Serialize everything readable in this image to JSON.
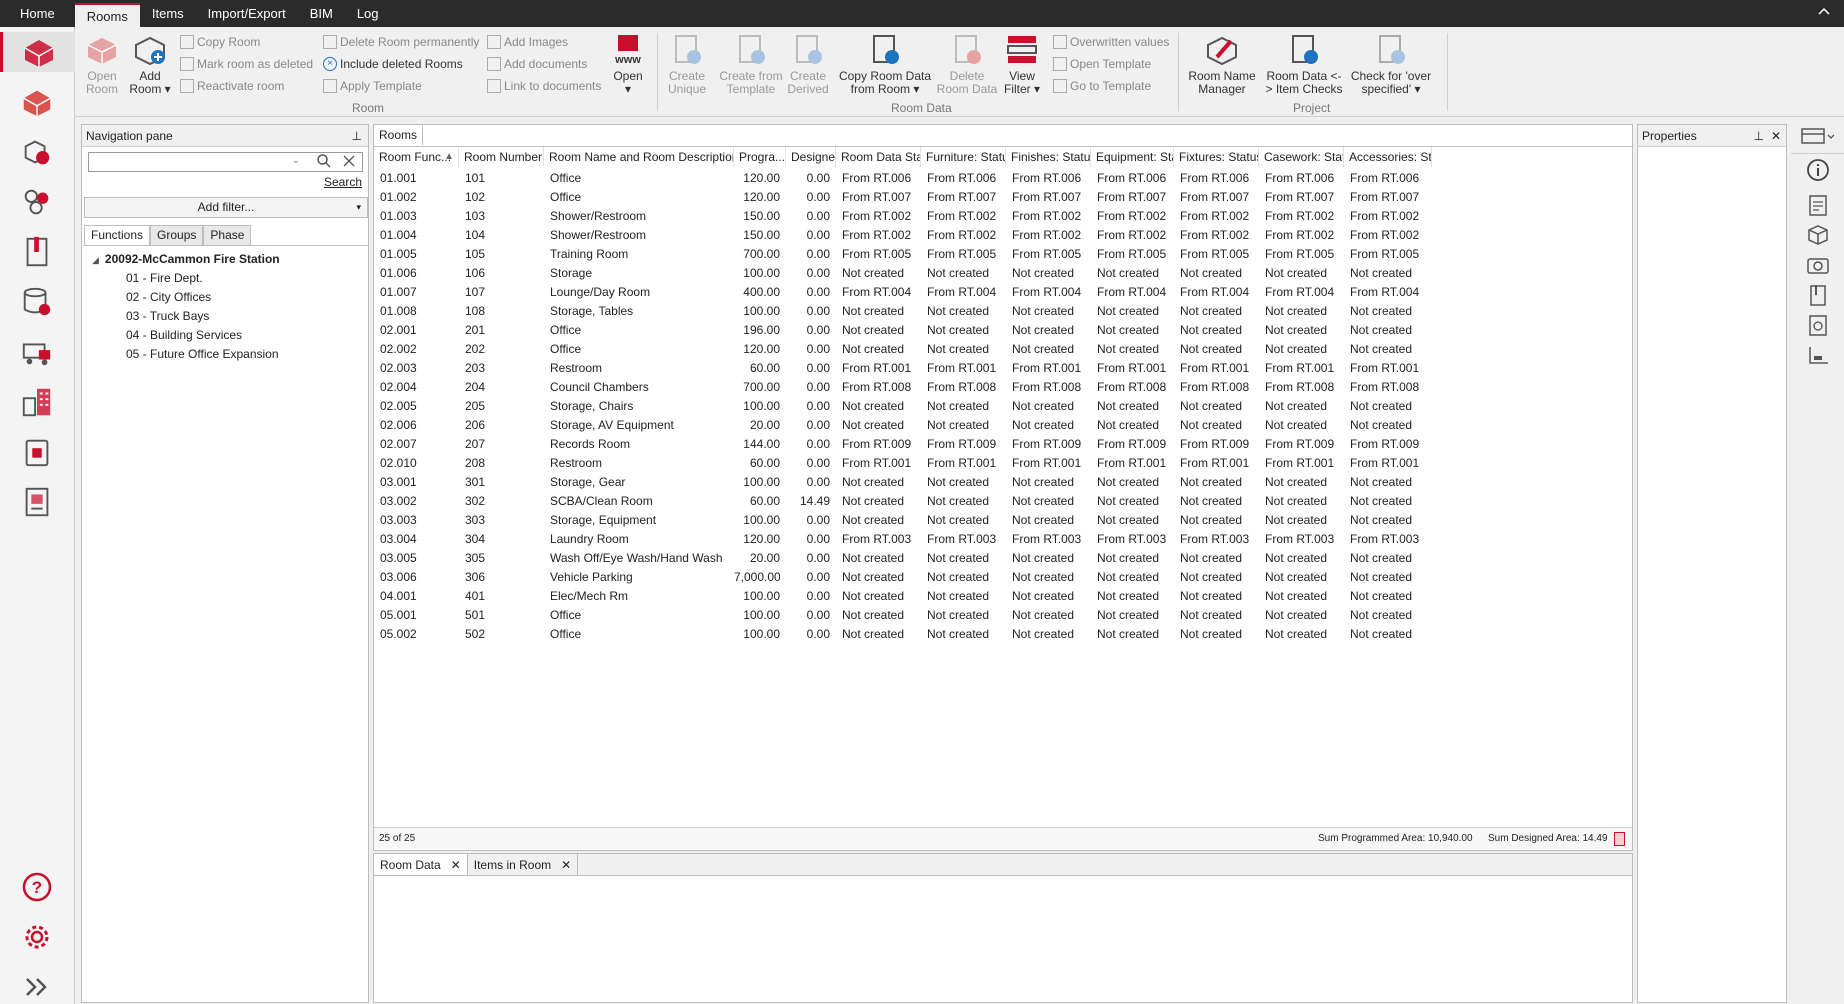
{
  "menu": {
    "tabs": [
      "Home",
      "Rooms",
      "Items",
      "Import/Export",
      "BIM",
      "Log"
    ],
    "active": "Rooms"
  },
  "ribbon": {
    "open_room": "Open\nRoom",
    "add_room": "Add\nRoom ▾",
    "copy_room": "Copy Room",
    "mark_deleted": "Mark room as deleted",
    "reactivate": "Reactivate room",
    "delete_permanently": "Delete Room permanently",
    "include_deleted": "Include deleted Rooms",
    "apply_template": "Apply Template",
    "add_images": "Add Images",
    "add_documents": "Add documents",
    "link_documents": "Link to documents",
    "open_www": "Open\n▾",
    "create_unique": "Create\nUnique",
    "create_from_template": "Create from\nTemplate",
    "create_derived": "Create\nDerived",
    "copy_room_data": "Copy Room Data\nfrom Room ▾",
    "delete_room_data": "Delete\nRoom Data",
    "view_filter": "View\nFilter ▾",
    "overwritten_values": "Overwritten values",
    "open_template": "Open Template",
    "go_to_template": "Go to Template",
    "room_name_manager": "Room Name\nManager",
    "room_data_item_checks": "Room Data <-\n> Item Checks",
    "check_over_specified": "Check for 'over\nspecified' ▾",
    "group_room": "Room",
    "group_room_data": "Room Data",
    "group_project": "Project",
    "www_label": "www"
  },
  "nav": {
    "title": "Navigation pane",
    "search_placeholder": "",
    "search_link": "Search",
    "add_filter": "Add filter...",
    "tabs": [
      "Functions",
      "Groups",
      "Phase"
    ],
    "root": "20092-McCammon Fire Station",
    "items": [
      "01 - Fire Dept.",
      "02 - City Offices",
      "03 - Truck Bays",
      "04 - Building Services",
      "05 - Future Office Expansion"
    ]
  },
  "rooms": {
    "tab_label": "Rooms",
    "columns": [
      "Room Func...",
      "Room Number",
      "Room Name and Room Description",
      "Progra...",
      "Designe...",
      "Room Data Stat...",
      "Furniture: Status",
      "Finishes: Status",
      "Equipment: Sta...",
      "Fixtures: Status",
      "Casework: Status",
      "Accessories: Sta..."
    ],
    "rows": [
      [
        "01.001",
        "101",
        "Office",
        "120.00",
        "0.00",
        "From RT.006"
      ],
      [
        "01.002",
        "102",
        "Office",
        "120.00",
        "0.00",
        "From RT.007"
      ],
      [
        "01.003",
        "103",
        "Shower/Restroom",
        "150.00",
        "0.00",
        "From RT.002"
      ],
      [
        "01.004",
        "104",
        "Shower/Restroom",
        "150.00",
        "0.00",
        "From RT.002"
      ],
      [
        "01.005",
        "105",
        "Training Room",
        "700.00",
        "0.00",
        "From RT.005"
      ],
      [
        "01.006",
        "106",
        "Storage",
        "100.00",
        "0.00",
        "Not created"
      ],
      [
        "01.007",
        "107",
        "Lounge/Day Room",
        "400.00",
        "0.00",
        "From RT.004"
      ],
      [
        "01.008",
        "108",
        "Storage, Tables",
        "100.00",
        "0.00",
        "Not created"
      ],
      [
        "02.001",
        "201",
        "Office",
        "196.00",
        "0.00",
        "Not created"
      ],
      [
        "02.002",
        "202",
        "Office",
        "120.00",
        "0.00",
        "Not created"
      ],
      [
        "02.003",
        "203",
        "Restroom",
        "60.00",
        "0.00",
        "From RT.001"
      ],
      [
        "02.004",
        "204",
        "Council Chambers",
        "700.00",
        "0.00",
        "From RT.008"
      ],
      [
        "02.005",
        "205",
        "Storage, Chairs",
        "100.00",
        "0.00",
        "Not created"
      ],
      [
        "02.006",
        "206",
        "Storage, AV Equipment",
        "20.00",
        "0.00",
        "Not created"
      ],
      [
        "02.007",
        "207",
        "Records Room",
        "144.00",
        "0.00",
        "From RT.009"
      ],
      [
        "02.010",
        "208",
        "Restroom",
        "60.00",
        "0.00",
        "From RT.001"
      ],
      [
        "03.001",
        "301",
        "Storage, Gear",
        "100.00",
        "0.00",
        "Not created"
      ],
      [
        "03.002",
        "302",
        "SCBA/Clean Room",
        "60.00",
        "14.49",
        "Not created"
      ],
      [
        "03.003",
        "303",
        "Storage, Equipment",
        "100.00",
        "0.00",
        "Not created"
      ],
      [
        "03.004",
        "304",
        "Laundry Room",
        "120.00",
        "0.00",
        "From RT.003"
      ],
      [
        "03.005",
        "305",
        "Wash Off/Eye Wash/Hand Wash",
        "20.00",
        "0.00",
        "Not created"
      ],
      [
        "03.006",
        "306",
        "Vehicle Parking",
        "7,000.00",
        "0.00",
        "Not created"
      ],
      [
        "04.001",
        "401",
        "Elec/Mech Rm",
        "100.00",
        "0.00",
        "Not created"
      ],
      [
        "05.001",
        "501",
        "Office",
        "100.00",
        "0.00",
        "Not created"
      ],
      [
        "05.002",
        "502",
        "Office",
        "100.00",
        "0.00",
        "Not created"
      ]
    ],
    "count": "25 of 25",
    "sum_programmed": "Sum Programmed Area: 10,940.00",
    "sum_designed": "Sum Designed Area: 14.49"
  },
  "bottom": {
    "tabs": [
      "Room Data",
      "Items in Room"
    ]
  },
  "properties": {
    "title": "Properties"
  },
  "colors": {
    "accent": "#c8102e",
    "menubar": "#2b2b2b"
  }
}
